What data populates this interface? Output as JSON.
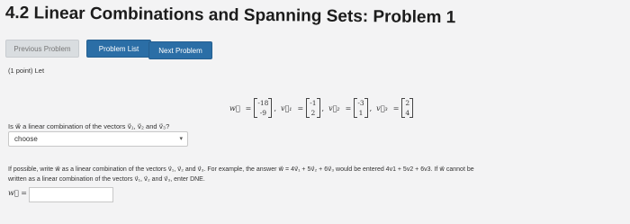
{
  "title": "4.2 Linear Combinations and Spanning Sets: Problem 1",
  "nav": {
    "previous": "Previous Problem",
    "list": "Problem List",
    "next": "Next Problem"
  },
  "points": "(1 point) Let",
  "equation": {
    "w_sym": "w⃗",
    "w": [
      "-18",
      "-9"
    ],
    "v1_sym": "v⃗₁",
    "v1": [
      "-1",
      "2"
    ],
    "v2_sym": "v⃗₂",
    "v2": [
      "-3",
      "1"
    ],
    "v3_sym": "v⃗₃",
    "v3": [
      "2",
      "4"
    ]
  },
  "question": "Is w⃗ a linear combination of the vectors v⃗₁, v⃗₂ and v⃗₃?",
  "select": {
    "value": "choose"
  },
  "instructions": {
    "line1": "If possible, write w⃗ as a linear combination of the vectors v⃗₁, v⃗₂ and v⃗₃. For example, the answer w⃗ = 4v⃗₁ + 5v⃗₂ + 6v⃗₃ would be entered 4v1 + 5v2 + 6v3. If w⃗ cannot be",
    "line2": "written as a linear combination of the vectors v⃗₁, v⃗₂ and v⃗₃, enter DNE."
  },
  "answer": {
    "label": "w⃗ =",
    "value": ""
  }
}
